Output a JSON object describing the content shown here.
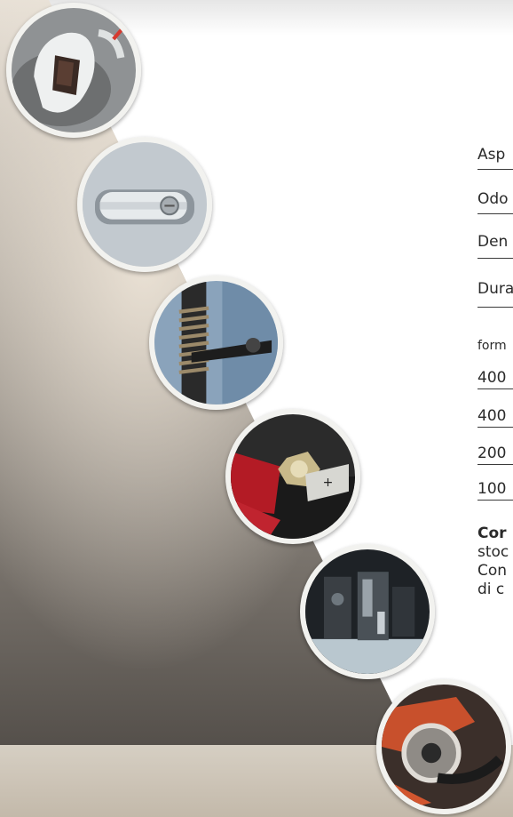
{
  "properties": [
    {
      "label": "Asp"
    },
    {
      "label": "Odo"
    },
    {
      "label": "Den"
    },
    {
      "label": "Dura"
    }
  ],
  "formats": {
    "heading": "form",
    "items": [
      {
        "label": "400"
      },
      {
        "label": "400"
      },
      {
        "label": "200"
      },
      {
        "label": "100"
      }
    ]
  },
  "note": {
    "bold": "Cor",
    "lines": [
      "stoc",
      "Con",
      "di c"
    ]
  },
  "photos": [
    {
      "icon": "white-grease-on-fitting"
    },
    {
      "icon": "car-door-handle"
    },
    {
      "icon": "engine-hose-clamp"
    },
    {
      "icon": "battery-terminal"
    },
    {
      "icon": "marine-engine"
    },
    {
      "icon": "motorcycle-chain"
    }
  ],
  "colors": {
    "background_dark": "#5c5752",
    "background_light": "#d9d3cb",
    "band": "#cfc6b8",
    "photo_border": "#f2f2ef"
  }
}
